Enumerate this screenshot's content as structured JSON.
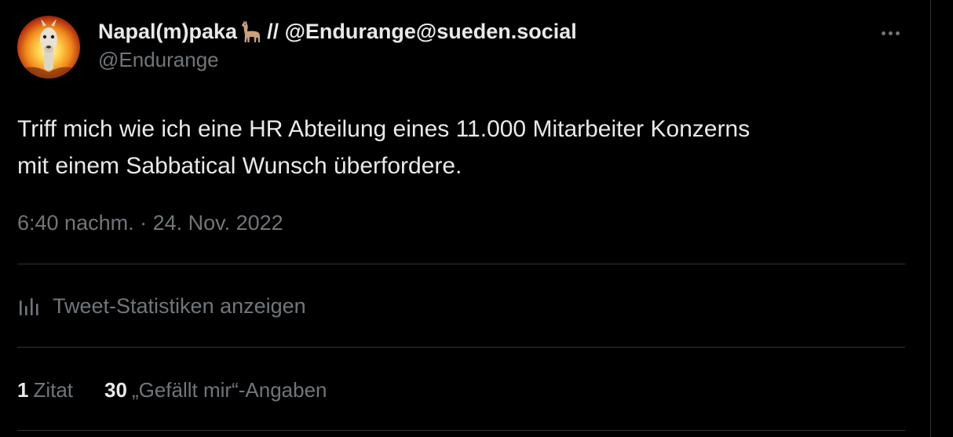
{
  "colors": {
    "background": "#000000",
    "text_primary": "#e7e9ea",
    "text_secondary": "#71767b",
    "divider": "#2f3336"
  },
  "author": {
    "display_name_prefix": "Napal(m)paka",
    "name_emoji": "llama-icon",
    "display_name_suffix": "// @Endurange@sueden.social",
    "handle": "@Endurange",
    "avatar": "llama-avatar"
  },
  "tweet": {
    "text_line_1": "Triff mich wie ich eine HR Abteilung eines 11.000 Mitarbeiter Konzerns",
    "text_line_2": "mit einem Sabbatical Wunsch überfordere.",
    "timestamp": "6:40 nachm. · 24. Nov. 2022"
  },
  "actions": {
    "more_icon": "more-horizontal-icon",
    "stats_icon": "bar-chart-icon",
    "stats_label": "Tweet-Statistiken anzeigen"
  },
  "counts": {
    "quotes_value": "1",
    "quotes_label": "Zitat",
    "likes_value": "30",
    "likes_label": "„Gefällt mir“-Angaben"
  }
}
